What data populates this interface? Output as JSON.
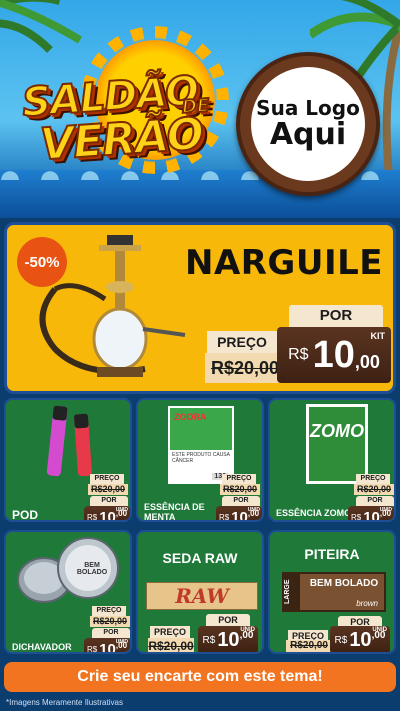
{
  "header": {
    "title_line1": "SALDÃO",
    "title_de": "DE",
    "title_line2": "VERÃO",
    "logo_line1": "Sua Logo",
    "logo_line2": "Aqui"
  },
  "featured": {
    "discount": "-50%",
    "name": "NARGUILE",
    "preco_label": "PREÇO",
    "old_price": "R$20,00",
    "por_label": "POR",
    "currency": "R$",
    "price_int": "10",
    "price_cents": ",00",
    "unit": "KIT"
  },
  "products": [
    {
      "name": "POD",
      "preco_label": "PREÇO",
      "old_price": "R$20,00",
      "por_label": "POR",
      "currency": "R$",
      "price_int": "10",
      "price_cents": ",00",
      "unit": "UNID"
    },
    {
      "name_line1": "ESSÊNCIA DE",
      "name_line2": "MENTA",
      "preco_label": "PREÇO",
      "old_price": "R$20,00",
      "por_label": "POR",
      "currency": "R$",
      "price_int": "10",
      "price_cents": ",00",
      "unit": "UNID",
      "box_brand": "ZOORA",
      "box_warning": "ESTE PRODUTO CAUSA CÂNCER",
      "box_code": "136"
    },
    {
      "name": "ESSÊNCIA ZOMO",
      "preco_label": "PREÇO",
      "old_price": "R$20,00",
      "por_label": "POR",
      "currency": "R$",
      "price_int": "10",
      "price_cents": ",00",
      "unit": "UNID",
      "box_brand": "ZOMO"
    },
    {
      "name": "DICHAVADOR",
      "preco_label": "PREÇO",
      "old_price": "R$20,00",
      "por_label": "POR",
      "currency": "R$",
      "price_int": "10",
      "price_cents": ",00",
      "unit": "UNID",
      "brand": "BEM BOLADO"
    },
    {
      "name": "SEDA RAW",
      "preco_label": "PREÇO",
      "old_price": "R$20,00",
      "por_label": "POR",
      "currency": "R$",
      "price_int": "10",
      "price_cents": ",00",
      "unit": "UNID",
      "brand": "RAW"
    },
    {
      "name": "PITEIRA",
      "preco_label": "PREÇO",
      "old_price": "R$20,00",
      "por_label": "POR",
      "currency": "R$",
      "price_int": "10",
      "price_cents": ",00",
      "unit": "UNID",
      "brand_side": "LARGE",
      "brand": "BEM BOLADO",
      "brand_sub": "brown"
    }
  ],
  "cta": "Crie seu encarte com este tema!",
  "disclaimer": "*Imagens Meramente Ilustrativas",
  "colors": {
    "featured_bg": "#f7b80a",
    "card_bg": "#1f7a3a",
    "cta_bg": "#f27420",
    "discount": "#e85314",
    "border": "#1e4f94"
  }
}
